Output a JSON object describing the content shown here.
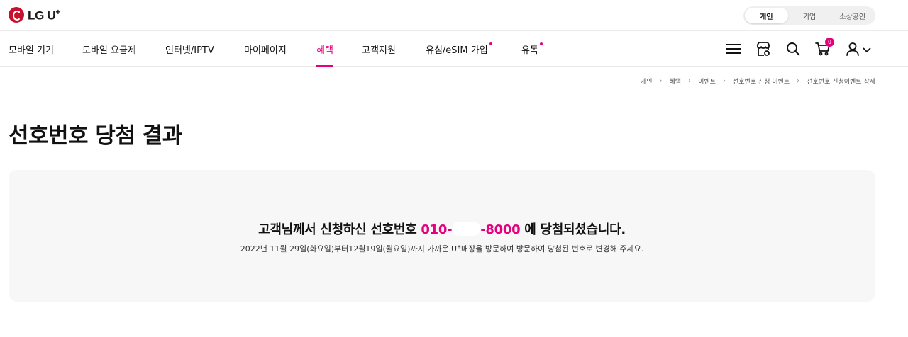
{
  "header": {
    "logo_text": "LG U",
    "logo_plus": "+",
    "segments": [
      "개인",
      "기업",
      "소상공인"
    ]
  },
  "nav": {
    "items": [
      {
        "label": "모바일 기기"
      },
      {
        "label": "모바일 요금제"
      },
      {
        "label": "인터넷/IPTV"
      },
      {
        "label": "마이페이지"
      },
      {
        "label": "혜택"
      },
      {
        "label": "고객지원"
      },
      {
        "label": "유심/eSIM 가입"
      },
      {
        "label": "유독"
      }
    ],
    "cart_count": "0"
  },
  "breadcrumb": [
    "개인",
    "혜택",
    "이벤트",
    "선호번호 신청 이벤트",
    "선호번호 신청이벤트 상세"
  ],
  "page_title": "선호번호 당첨 결과",
  "result": {
    "main_before": "고객님께서 신청하신 선호번호 ",
    "number_prefix": "010-",
    "number_suffix": "-8000",
    "main_after": " 에 당첨되셨습니다.",
    "sub_before": "2022년 11월 29일(화요일)부터12월19일(월요일)까지 가까운 U",
    "sub_sup": "+",
    "sub_after": "매장을 방문하여 방문하여 당첨된 번호로 변경해 주세요."
  },
  "colors": {
    "accent": "#e6007e",
    "brand_red": "#c8102e",
    "box_bg": "#f7f7f7"
  },
  "icons": [
    "menu-icon",
    "store-icon",
    "search-icon",
    "cart-icon",
    "user-icon",
    "chevron-down-icon",
    "chevron-right-icon"
  ]
}
